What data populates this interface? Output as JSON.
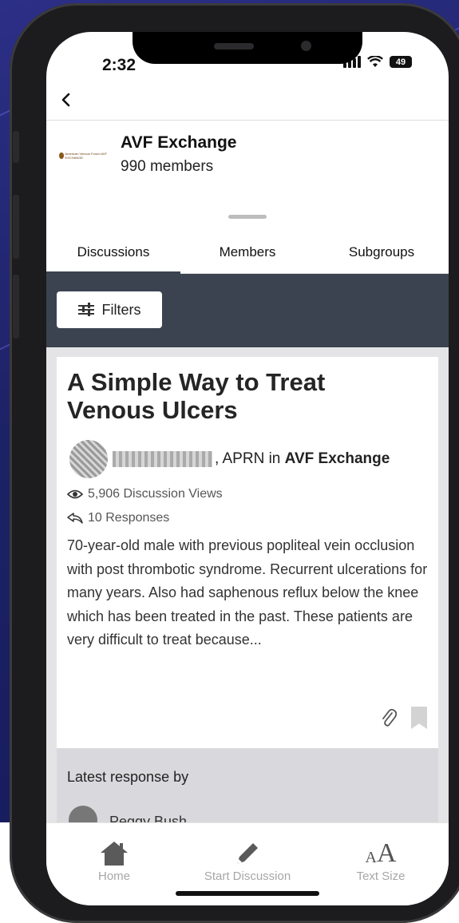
{
  "status": {
    "time": "2:32",
    "battery": "49"
  },
  "group": {
    "name": "AVF Exchange",
    "members": "990 members",
    "logo_text": "American Venous Forum AVF EXCHANGE"
  },
  "tabs": [
    {
      "label": "Discussions"
    },
    {
      "label": "Members"
    },
    {
      "label": "Subgroups"
    }
  ],
  "filters": {
    "label": "Filters"
  },
  "discussion": {
    "title": "A Simple Way to Treat Venous Ulcers",
    "author_suffix": ", APRN in ",
    "group_ref": "AVF Exchange",
    "views": "5,906 Discussion Views",
    "responses": "10 Responses",
    "body": "70-year-old male with previous popliteal vein occlusion with post thrombotic syndrome. Recurrent ulcerations for many years. Also had saphenous reflux below the knee which has been treated in the past. These patients are very difficult to treat because..."
  },
  "latest": {
    "label": "Latest response by",
    "name": "Peggy Bush"
  },
  "nav": [
    {
      "label": "Home",
      "icon": "home-icon"
    },
    {
      "label": "Start Discussion",
      "icon": "pencil-icon"
    },
    {
      "label": "Text Size",
      "icon": "text-size-icon"
    }
  ],
  "colors": {
    "header_band": "#3b4350",
    "content_bg": "#e4e4e6",
    "nav_label": "#a7a7a7"
  }
}
